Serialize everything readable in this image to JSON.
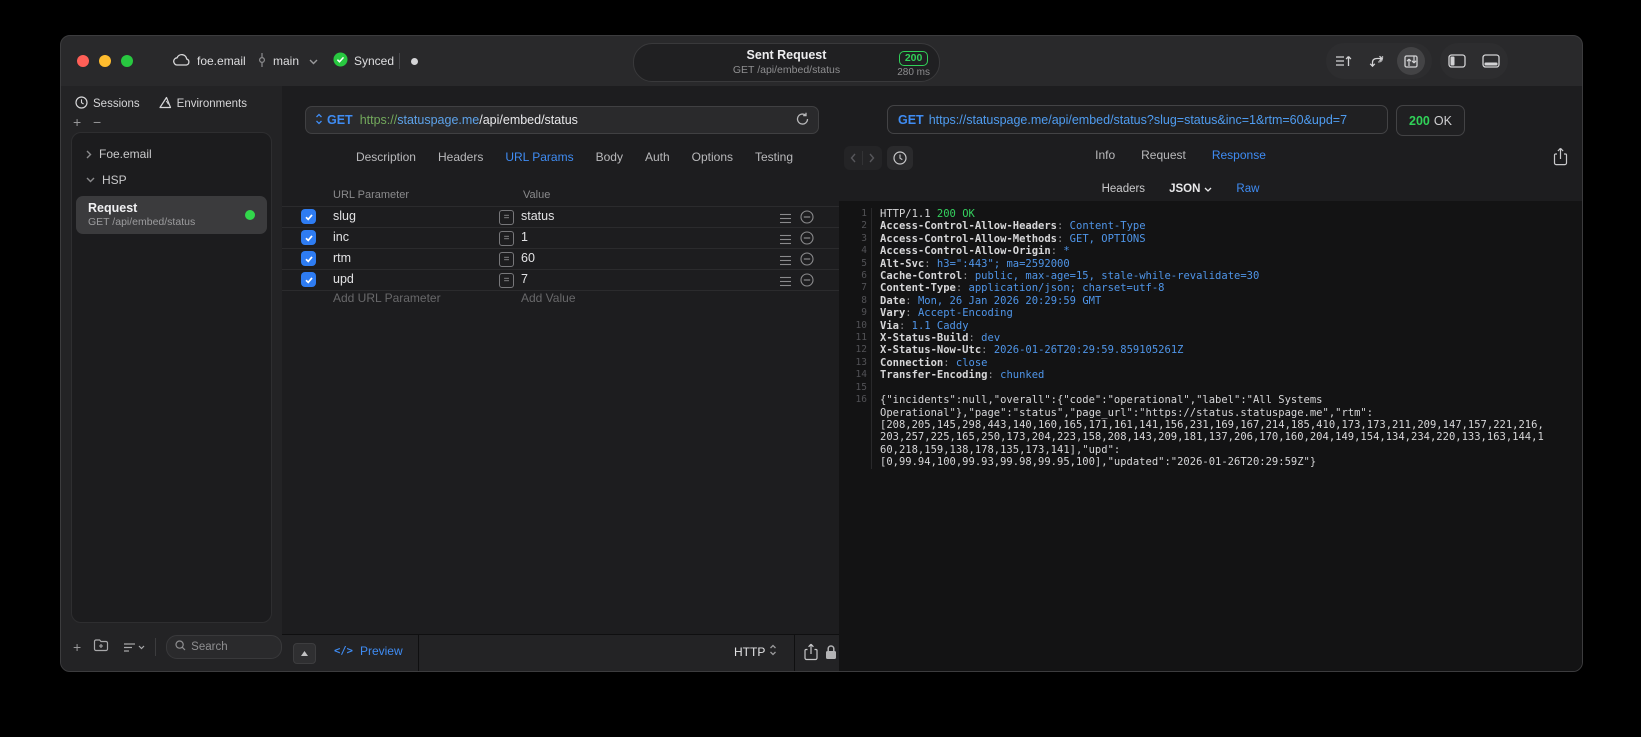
{
  "titlebar": {
    "project": "foe.email",
    "branch": "main",
    "sync_label": "Synced",
    "request_summary": {
      "title": "Sent Request",
      "subtitle": "GET /api/embed/status",
      "status_code": "200",
      "duration": "280 ms"
    }
  },
  "sidebar": {
    "tabs": [
      {
        "label": "Sessions"
      },
      {
        "label": "Environments"
      }
    ],
    "group_collapsed": "Foe.email",
    "group_expanded": "HSP",
    "request_item": {
      "title": "Request",
      "subtitle": "GET /api/embed/status"
    },
    "search_placeholder": "Search"
  },
  "request_editor": {
    "method": "GET",
    "url": {
      "scheme": "https://",
      "host": "statuspage.me",
      "path": "/api/embed/status"
    },
    "tabs": [
      "Description",
      "Headers",
      "URL Params",
      "Body",
      "Auth",
      "Options",
      "Testing"
    ],
    "active_tab": "URL Params",
    "params": {
      "columns": [
        "URL Parameter",
        "Value"
      ],
      "rows": [
        {
          "enabled": true,
          "name": "slug",
          "value": "status"
        },
        {
          "enabled": true,
          "name": "inc",
          "value": "1"
        },
        {
          "enabled": true,
          "name": "rtm",
          "value": "60"
        },
        {
          "enabled": true,
          "name": "upd",
          "value": "7"
        }
      ],
      "add_row": {
        "name_placeholder": "Add URL Parameter",
        "value_placeholder": "Add Value"
      }
    },
    "footer": {
      "preview": "Preview",
      "protocol": "HTTP"
    }
  },
  "response_viewer": {
    "method": "GET",
    "url": "https://statuspage.me/api/embed/status?slug=status&inc=1&rtm=60&upd=7",
    "status_code": "200",
    "status_text": "OK",
    "tabs": [
      "Info",
      "Request",
      "Response"
    ],
    "active_tab": "Response",
    "subtabs": [
      "Headers",
      "JSON",
      "Raw"
    ],
    "active_subtab": "Raw",
    "raw": {
      "status_line": {
        "protocol": "HTTP/1.1",
        "status": "200 OK"
      },
      "headers": [
        {
          "name": "Access-Control-Allow-Headers",
          "value": "Content-Type"
        },
        {
          "name": "Access-Control-Allow-Methods",
          "value": "GET, OPTIONS"
        },
        {
          "name": "Access-Control-Allow-Origin",
          "value": "*"
        },
        {
          "name": "Alt-Svc",
          "value": "h3=\":443\"; ma=2592000"
        },
        {
          "name": "Cache-Control",
          "value": "public, max-age=15, stale-while-revalidate=30"
        },
        {
          "name": "Content-Type",
          "value": "application/json; charset=utf-8"
        },
        {
          "name": "Date",
          "value": "Mon, 26 Jan 2026 20:29:59 GMT"
        },
        {
          "name": "Vary",
          "value": "Accept-Encoding"
        },
        {
          "name": "Via",
          "value": "1.1 Caddy"
        },
        {
          "name": "X-Status-Build",
          "value": "dev"
        },
        {
          "name": "X-Status-Now-Utc",
          "value": "2026-01-26T20:29:59.859105261Z"
        },
        {
          "name": "Connection",
          "value": "close"
        },
        {
          "name": "Transfer-Encoding",
          "value": "chunked"
        }
      ],
      "body_lines": [
        "{\"incidents\":null,\"overall\":{\"code\":\"operational\",\"label\":\"All Systems",
        "Operational\"},\"page\":\"status\",\"page_url\":\"https://status.statuspage.me\",\"rtm\":",
        "[208,205,145,298,443,140,160,165,171,161,141,156,231,169,167,214,185,410,173,173,211,209,147,157,221,216,",
        "203,257,225,165,250,173,204,223,158,208,143,209,181,137,206,170,160,204,149,154,134,234,220,133,163,144,1",
        "60,218,159,138,178,135,173,141],\"upd\":",
        "[0,99.94,100,99.93,99.98,99.95,100],\"updated\":\"2026-01-26T20:29:59Z\"}"
      ]
    }
  },
  "colors": {
    "accent_blue": "#3f8cf3",
    "success_green": "#30d158",
    "url_blue": "#4f9cf0",
    "scheme_green": "#73a95c"
  }
}
